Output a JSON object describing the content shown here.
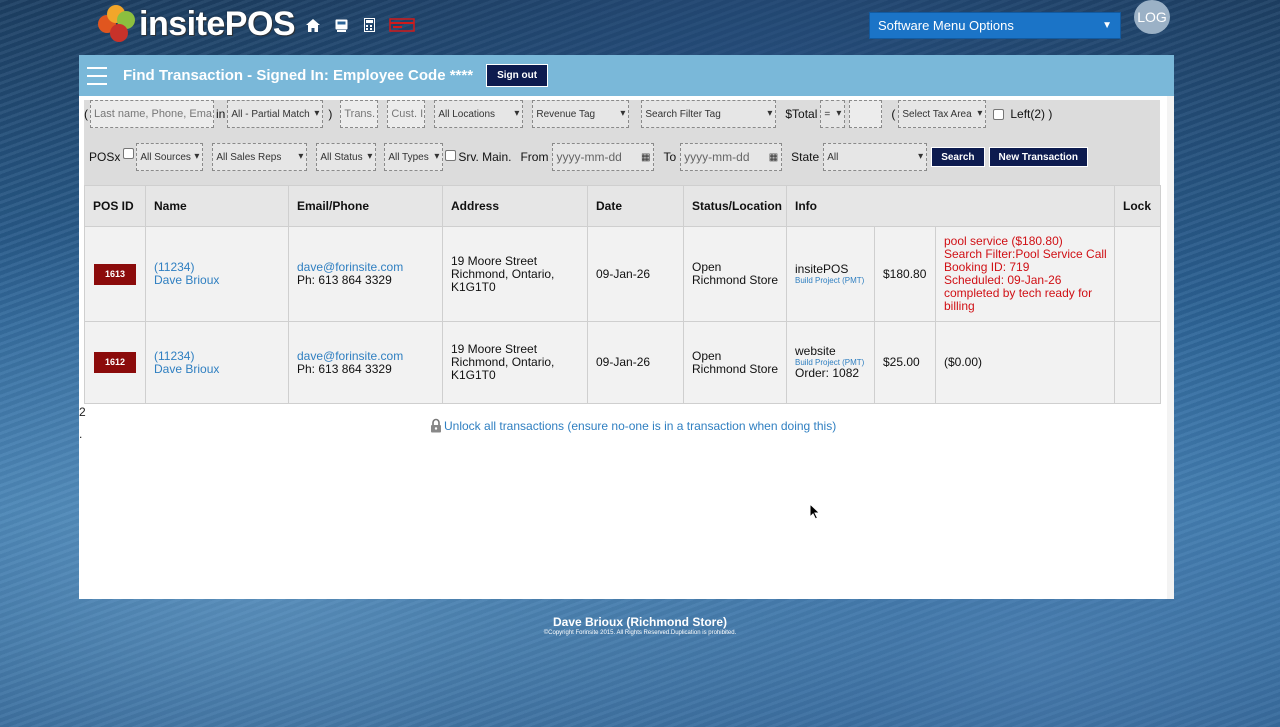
{
  "app": {
    "logo_text": "insitePOS",
    "menu_select": "Software Menu Options",
    "log_label": "LOG"
  },
  "header": {
    "title": "Find Transaction - Signed In: Employee Code ****",
    "signout": "Sign out"
  },
  "filters": {
    "row1": {
      "open_paren": "(",
      "search_placeholder": "Last name, Phone, Ema",
      "in_label": "in",
      "match_select": "All - Partial Match",
      "close_paren": ")",
      "trans_placeholder": "Trans.",
      "cust_placeholder": "Cust. I",
      "locations_select": "All Locations",
      "revenue_select": "Revenue Tag",
      "filter_tag_select": "Search Filter Tag",
      "total_label": "$Total",
      "total_op": "=",
      "tax_open_paren": "(",
      "tax_select": "Select Tax Area",
      "left_label": "Left(2) )"
    },
    "row2": {
      "posx_label": "POSx",
      "sources_select": "All Sources",
      "reps_select": "All Sales Reps",
      "status_select": "All Status",
      "types_select": "All Types",
      "srv_label": "Srv. Main.",
      "from_label": "From",
      "from_placeholder": "yyyy-mm-dd",
      "to_label": "To",
      "to_placeholder": "yyyy-mm-dd",
      "state_label": "State",
      "state_select": "All",
      "search_button": "Search",
      "new_button": "New Transaction"
    }
  },
  "table": {
    "columns": [
      "POS ID",
      "Name",
      "Email/Phone",
      "Address",
      "Date",
      "Status/Location",
      "Info",
      "Lock"
    ],
    "rows": [
      {
        "pos_id": "1613",
        "cust_no": "(11234)",
        "cust_name": "Dave Brioux",
        "email": "dave@forinsite.com",
        "phone": "Ph: 613 864 3329",
        "addr1": "19 Moore Street",
        "addr2": "Richmond, Ontario,",
        "addr3": "K1G1T0",
        "date": "09-Jan-26",
        "status": "Open",
        "location": "Richmond Store",
        "info_source": "insitePOS",
        "info_link": "Build Project (PMT)",
        "info_order": "",
        "total": "$180.80",
        "notes": [
          "pool service ($180.80)",
          "Search Filter:Pool Service Call",
          "Booking ID: 719",
          "Scheduled: 09-Jan-26",
          "completed by tech ready for",
          "billing"
        ]
      },
      {
        "pos_id": "1612",
        "cust_no": "(11234)",
        "cust_name": "Dave Brioux",
        "email": "dave@forinsite.com",
        "phone": "Ph: 613 864 3329",
        "addr1": "19 Moore Street",
        "addr2": "Richmond, Ontario,",
        "addr3": "K1G1T0",
        "date": "09-Jan-26",
        "status": "Open",
        "location": "Richmond Store",
        "info_source": "website",
        "info_link": "Build Project (PMT)",
        "info_order": "Order: 1082",
        "total": "$25.00",
        "balance": "($0.00)"
      }
    ]
  },
  "results_count": "2",
  "results_dot": ".",
  "unlock_text": "Unlock all transactions (ensure no-one is in a transaction when doing this)",
  "footer": {
    "user": "Dave Brioux (Richmond Store)",
    "copyright": "©Copyright Forinsite 2015. All Rights Reserved.Duplication is prohibited."
  },
  "colors": {
    "header_bar": "#7ab8d9",
    "dark_button": "#0d1b4f",
    "pos_badge": "#8b0b0b",
    "link": "#2f7fc1",
    "note_red": "#d01015",
    "menu_select": "#1b74c7"
  },
  "icons": [
    "home-icon",
    "register-icon",
    "calculator-icon",
    "credit-card-icon",
    "hamburger-icon",
    "lock-icon"
  ]
}
